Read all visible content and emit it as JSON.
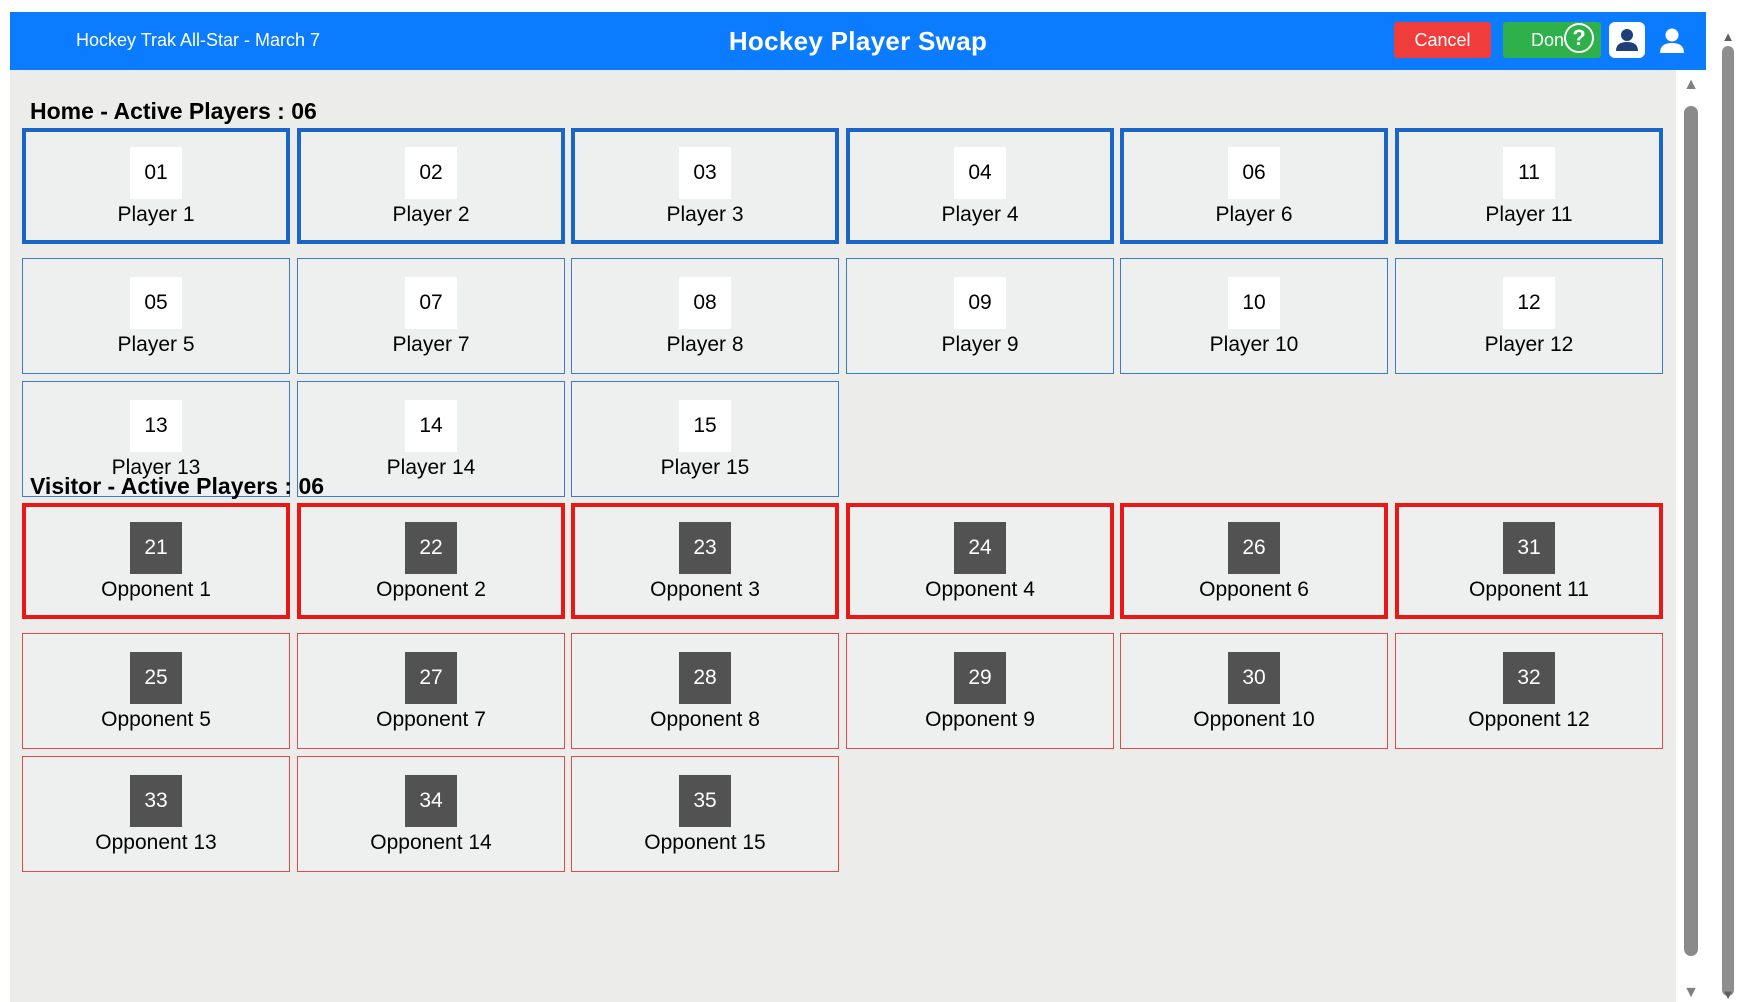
{
  "header": {
    "event_title": "Hockey Trak All-Star - March 7",
    "app_title": "Hockey Player Swap",
    "cancel_label": "Cancel",
    "done_label": "Done",
    "help_label": "?"
  },
  "home": {
    "section_title": "Home - Active Players : 06",
    "players": [
      {
        "number": "01",
        "name": "Player 1",
        "active": true
      },
      {
        "number": "02",
        "name": "Player 2",
        "active": true
      },
      {
        "number": "03",
        "name": "Player 3",
        "active": true
      },
      {
        "number": "04",
        "name": "Player 4",
        "active": true
      },
      {
        "number": "06",
        "name": "Player 6",
        "active": true
      },
      {
        "number": "11",
        "name": "Player 11",
        "active": true
      },
      {
        "number": "05",
        "name": "Player 5",
        "active": false
      },
      {
        "number": "07",
        "name": "Player 7",
        "active": false
      },
      {
        "number": "08",
        "name": "Player 8",
        "active": false
      },
      {
        "number": "09",
        "name": "Player 9",
        "active": false
      },
      {
        "number": "10",
        "name": "Player 10",
        "active": false
      },
      {
        "number": "12",
        "name": "Player 12",
        "active": false
      },
      {
        "number": "13",
        "name": "Player 13",
        "active": false
      },
      {
        "number": "14",
        "name": "Player 14",
        "active": false
      },
      {
        "number": "15",
        "name": "Player 15",
        "active": false
      }
    ]
  },
  "visitor": {
    "section_title": "Visitor - Active Players : 06",
    "players": [
      {
        "number": "21",
        "name": "Opponent 1",
        "active": true
      },
      {
        "number": "22",
        "name": "Opponent 2",
        "active": true
      },
      {
        "number": "23",
        "name": "Opponent 3",
        "active": true
      },
      {
        "number": "24",
        "name": "Opponent 4",
        "active": true
      },
      {
        "number": "26",
        "name": "Opponent 6",
        "active": true
      },
      {
        "number": "31",
        "name": "Opponent 11",
        "active": true
      },
      {
        "number": "25",
        "name": "Opponent 5",
        "active": false
      },
      {
        "number": "27",
        "name": "Opponent 7",
        "active": false
      },
      {
        "number": "28",
        "name": "Opponent 8",
        "active": false
      },
      {
        "number": "29",
        "name": "Opponent 9",
        "active": false
      },
      {
        "number": "30",
        "name": "Opponent 10",
        "active": false
      },
      {
        "number": "32",
        "name": "Opponent 12",
        "active": false
      },
      {
        "number": "33",
        "name": "Opponent 13",
        "active": false
      },
      {
        "number": "34",
        "name": "Opponent 14",
        "active": false
      },
      {
        "number": "35",
        "name": "Opponent 15",
        "active": false
      }
    ]
  },
  "colors": {
    "header_bg": "#0b7cff",
    "cancel_bg": "#f13c3c",
    "done_bg": "#2eb04a",
    "home_border": "#1a66c6",
    "visitor_border": "#ea1717",
    "visitor_number_bg": "#525252"
  },
  "icons": [
    "help-icon",
    "profile-card-icon",
    "user-icon",
    "scroll-up-arrow-icon",
    "scroll-down-arrow-icon"
  ]
}
